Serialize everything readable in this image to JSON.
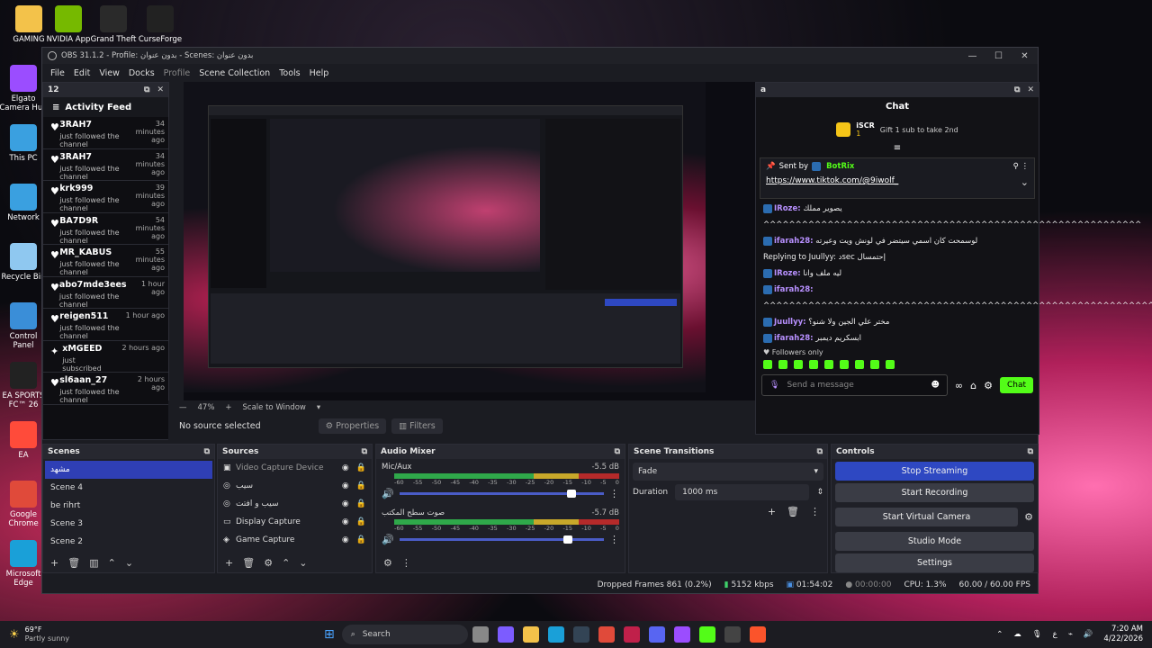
{
  "desktop_icons": [
    {
      "label": "GAMING",
      "color": "#f3c24a"
    },
    {
      "label": "NVIDIA App",
      "color": "#76b900"
    },
    {
      "label": "Grand Theft",
      "color": "#2a2a2a"
    },
    {
      "label": "CurseForge",
      "color": "#222"
    },
    {
      "label": "Elgato Camera Hub",
      "color": "#9b4dff"
    },
    {
      "label": "This PC",
      "color": "#3aa0e0"
    },
    {
      "label": "Network",
      "color": "#3aa0e0"
    },
    {
      "label": "Recycle Bin",
      "color": "#8fc8f0"
    },
    {
      "label": "Control Panel",
      "color": "#3a8ed8"
    },
    {
      "label": "EA SPORTS FC™ 26",
      "color": "#222"
    },
    {
      "label": "EA",
      "color": "#ff4b3a"
    },
    {
      "label": "Google Chrome",
      "color": "#e04a3a"
    },
    {
      "label": "Microsoft Edge",
      "color": "#1aa0d8"
    }
  ],
  "window": {
    "title": "OBS 31.1.2 - Profile: بدون عنوان - Scenes: بدون عنوان"
  },
  "menu": [
    "File",
    "Edit",
    "View",
    "Docks",
    "Profile",
    "Scene Collection",
    "Tools",
    "Help"
  ],
  "activity": {
    "dock_title": "12",
    "title": "Activity Feed",
    "items": [
      {
        "name": "3RAH7",
        "action": "just followed the channel",
        "time": "34 minutes ago"
      },
      {
        "name": "3RAH7",
        "action": "just followed the channel",
        "time": "34 minutes ago"
      },
      {
        "name": "krk999",
        "action": "just followed the channel",
        "time": "39 minutes ago"
      },
      {
        "name": "BA7D9R",
        "action": "just followed the channel",
        "time": "54 minutes ago"
      },
      {
        "name": "MR_KABUS",
        "action": "just followed the channel",
        "time": "55 minutes ago"
      },
      {
        "name": "abo7mde3ees",
        "action": "just followed the channel",
        "time": "1 hour ago"
      },
      {
        "name": "reigen511",
        "action": "just followed the channel",
        "time": "1 hour ago"
      },
      {
        "name": "xMGEED",
        "action": "just subscribed",
        "time": "2 hours ago"
      },
      {
        "name": "sl6aan_27",
        "action": "just followed the channel",
        "time": "2 hours ago"
      }
    ]
  },
  "preview_bar": {
    "zoom": "47%",
    "scale": "Scale to Window",
    "no_source": "No source selected",
    "properties": "Properties",
    "filters": "Filters"
  },
  "chat": {
    "dock_title": "a",
    "title": "Chat",
    "gift_user": "iSCR",
    "gift_count": "1",
    "gift_text": "Gift 1 sub to take 2nd",
    "pinned_label": "Sent by",
    "pinned_author": "BotRix",
    "pinned_link": "https://www.tiktok.com/@9iwolf_",
    "messages": [
      {
        "user": "IRoze:",
        "text": "يصوير مملك"
      },
      {
        "user": "",
        "text": "^^^^^^^^^^^^^^^^^^^^^^^^^^^^^^^^^^^^^^^^^^^^^^^^^^^^^^^^^^^"
      },
      {
        "user": "ifarah28:",
        "text": "لوسمحت كان اسمي سيتضر في لونش ويت وعيرته"
      },
      {
        "user": "",
        "text": "Replying to Juullyy: دsec إحتمسال"
      },
      {
        "user": "IRoze:",
        "text": "ليه ملف وانا"
      },
      {
        "user": "ifarah28:",
        "text": ""
      },
      {
        "user": "",
        "text": "^^^^^^^^^^^^^^^^^^^^^^^^^^^^^^^^^^^^^^^^^^^^^^^^^^^^^^^^^^^^^"
      },
      {
        "user": "Juullyy:",
        "text": "مختر علي الجين ولا شنو؟"
      },
      {
        "user": "ifarah28:",
        "text": "ابسكريم ديمبر"
      }
    ],
    "followers_only": "Followers only",
    "placeholder": "Send a message",
    "chat_button": "Chat"
  },
  "scenes": {
    "title": "Scenes",
    "items": [
      "مشهد",
      "Scene 4",
      "be rihrt",
      "Scene 3",
      "Scene 2"
    ]
  },
  "sources": {
    "title": "Sources",
    "items": [
      {
        "name": "Video Capture Device"
      },
      {
        "name": "سيب"
      },
      {
        "name": "سيب و افتت"
      },
      {
        "name": "Display Capture"
      },
      {
        "name": "Game Capture"
      }
    ]
  },
  "mixer": {
    "title": "Audio Mixer",
    "channels": [
      {
        "name": "Mic/Aux",
        "db": "-5.5 dB",
        "level": 0.82
      },
      {
        "name": "صوت سطح المكتب",
        "db": "-5.7 dB",
        "level": 0.8
      }
    ],
    "ticks": [
      "-60",
      "-55",
      "-50",
      "-45",
      "-40",
      "-35",
      "-30",
      "-25",
      "-20",
      "-15",
      "-10",
      "-5",
      "0"
    ]
  },
  "transitions": {
    "title": "Scene Transitions",
    "type": "Fade",
    "duration_label": "Duration",
    "duration": "1000 ms"
  },
  "controls": {
    "title": "Controls",
    "buttons": [
      "Stop Streaming",
      "Start Recording",
      "Start Virtual Camera",
      "Studio Mode",
      "Settings"
    ]
  },
  "status": {
    "dropped": "Dropped Frames 861 (0.2%)",
    "kbps": "5152 kbps",
    "live": "01:54:02",
    "rec": "00:00:00",
    "cpu": "CPU: 1.3%",
    "fps": "60.00 / 60.00 FPS"
  },
  "taskbar": {
    "weather_temp": "69°F",
    "weather_desc": "Partly sunny",
    "search": "Search",
    "time": "7:20 AM",
    "date": "4/22/2026",
    "lang": "ع"
  }
}
